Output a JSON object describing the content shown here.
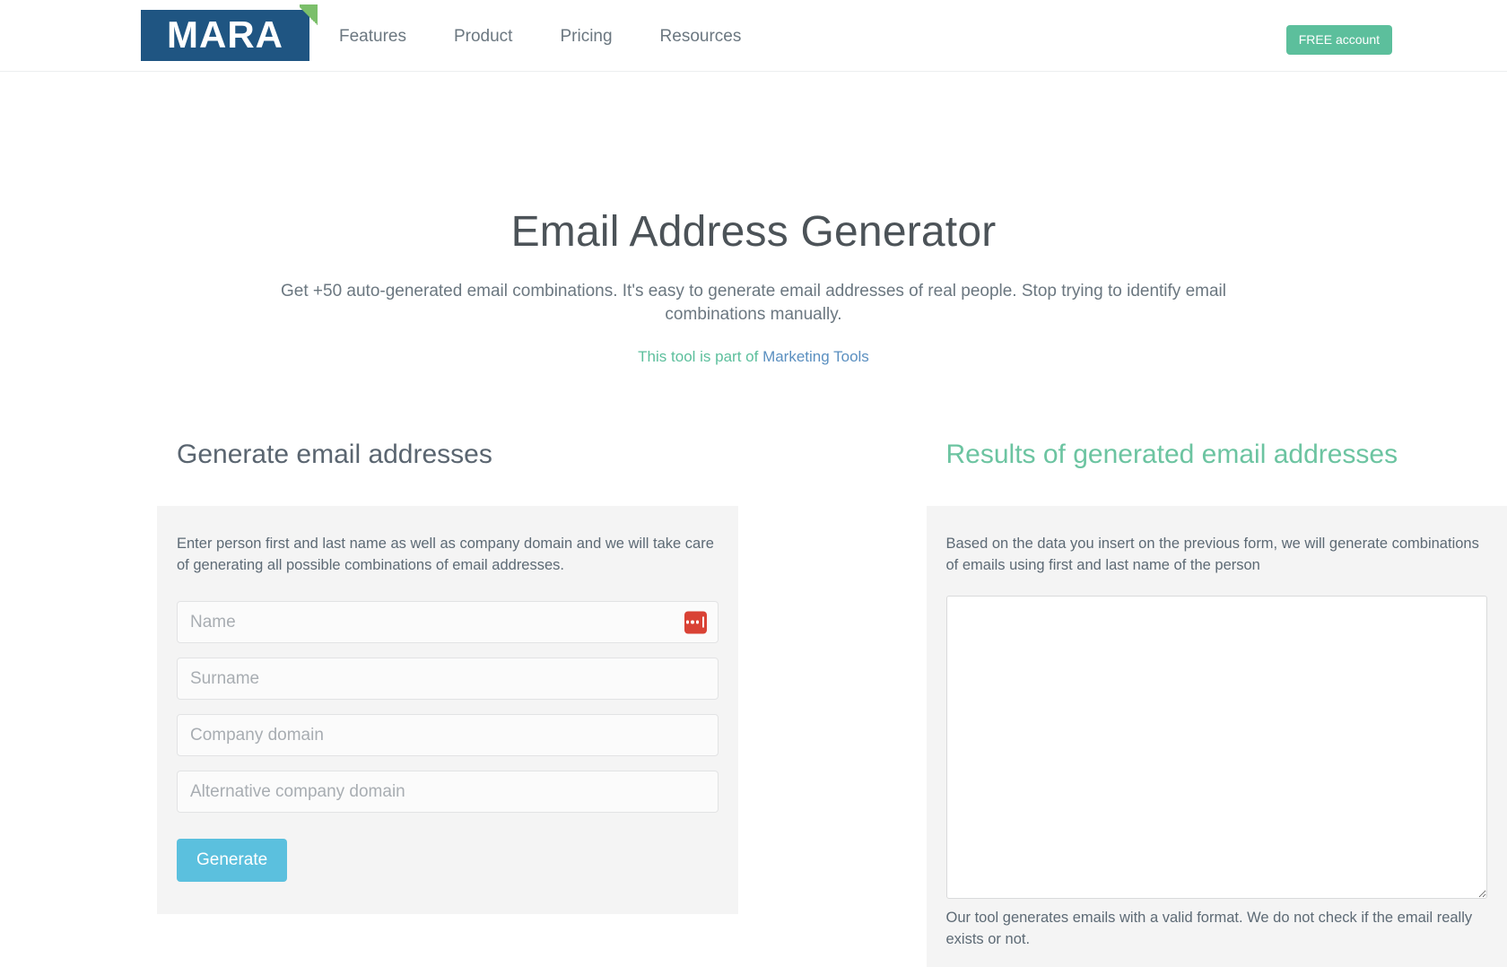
{
  "header": {
    "logo_text": "MARA",
    "nav": [
      {
        "label": "Features"
      },
      {
        "label": "Product"
      },
      {
        "label": "Pricing"
      },
      {
        "label": "Resources"
      }
    ],
    "cta_label": "FREE account",
    "cta_color": "#5cbf9c",
    "logo_bg_color": "#1f5582",
    "logo_accent_color": "#7bbf6a"
  },
  "hero": {
    "title": "Email Address Generator",
    "subtitle": "Get +50 auto-generated email combinations. It's easy to generate email addresses of real people. Stop trying to identify email combinations manually.",
    "tool_prefix": "This tool is part of ",
    "tool_link": "Marketing Tools",
    "tool_prefix_color": "#5cbf9c",
    "tool_link_color": "#5a8fc0"
  },
  "left_panel": {
    "title": "Generate email addresses",
    "title_color": "#5a6570",
    "description": "Enter person first and last name as well as company domain and we will take care of generating all possible combinations of email addresses.",
    "fields": [
      {
        "name": "name",
        "placeholder": "Name",
        "value": "",
        "has_password_manager_icon": true
      },
      {
        "name": "surname",
        "placeholder": "Surname",
        "value": "",
        "has_password_manager_icon": false
      },
      {
        "name": "company_domain",
        "placeholder": "Company domain",
        "value": "",
        "has_password_manager_icon": false
      },
      {
        "name": "alternative_company_domain",
        "placeholder": "Alternative company domain",
        "value": "",
        "has_password_manager_icon": false
      }
    ],
    "submit_label": "Generate",
    "submit_color": "#5bc0de",
    "password_manager_icon": "lastpass-icon",
    "password_manager_color": "#d94235"
  },
  "right_panel": {
    "title": "Results of generated email addresses",
    "title_color": "#6cc4a1",
    "description": "Based on the data you insert on the previous form, we will generate combinations of emails using first and last name of the person",
    "results_value": "",
    "results_placeholder": "",
    "note": "Our tool generates emails with a valid format. We do not check if the email really exists or not."
  }
}
